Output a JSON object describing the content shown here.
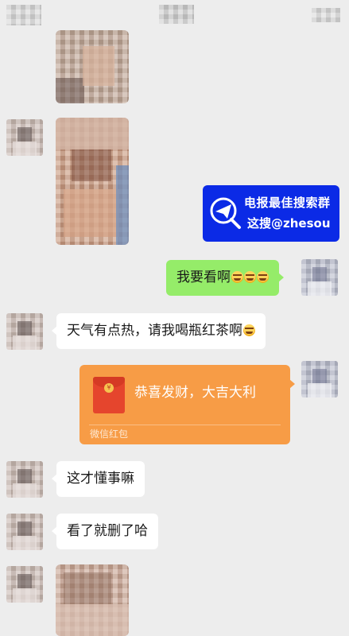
{
  "header": {
    "title": "",
    "left": "",
    "right": ""
  },
  "ad": {
    "line1": "电报最佳搜索群",
    "line2": "这搜@zhesou"
  },
  "messages": {
    "m1": "我要看啊",
    "m2": "天气有点热，请我喝瓶红茶啊",
    "m4": "这才懂事嘛",
    "m5": "看了就删了哈"
  },
  "red_packet": {
    "title": "恭喜发财，大吉大利",
    "footer": "微信红包",
    "coin_glyph": "¥"
  },
  "icons": {
    "emoji_crying": "loudly-crying-face-emoji",
    "emoji_laughing": "tears-of-joy-emoji"
  },
  "colors": {
    "background": "#ededed",
    "sent_bubble": "#95ec69",
    "red_packet": "#f79c46",
    "ad_banner": "#0b2ae6"
  }
}
